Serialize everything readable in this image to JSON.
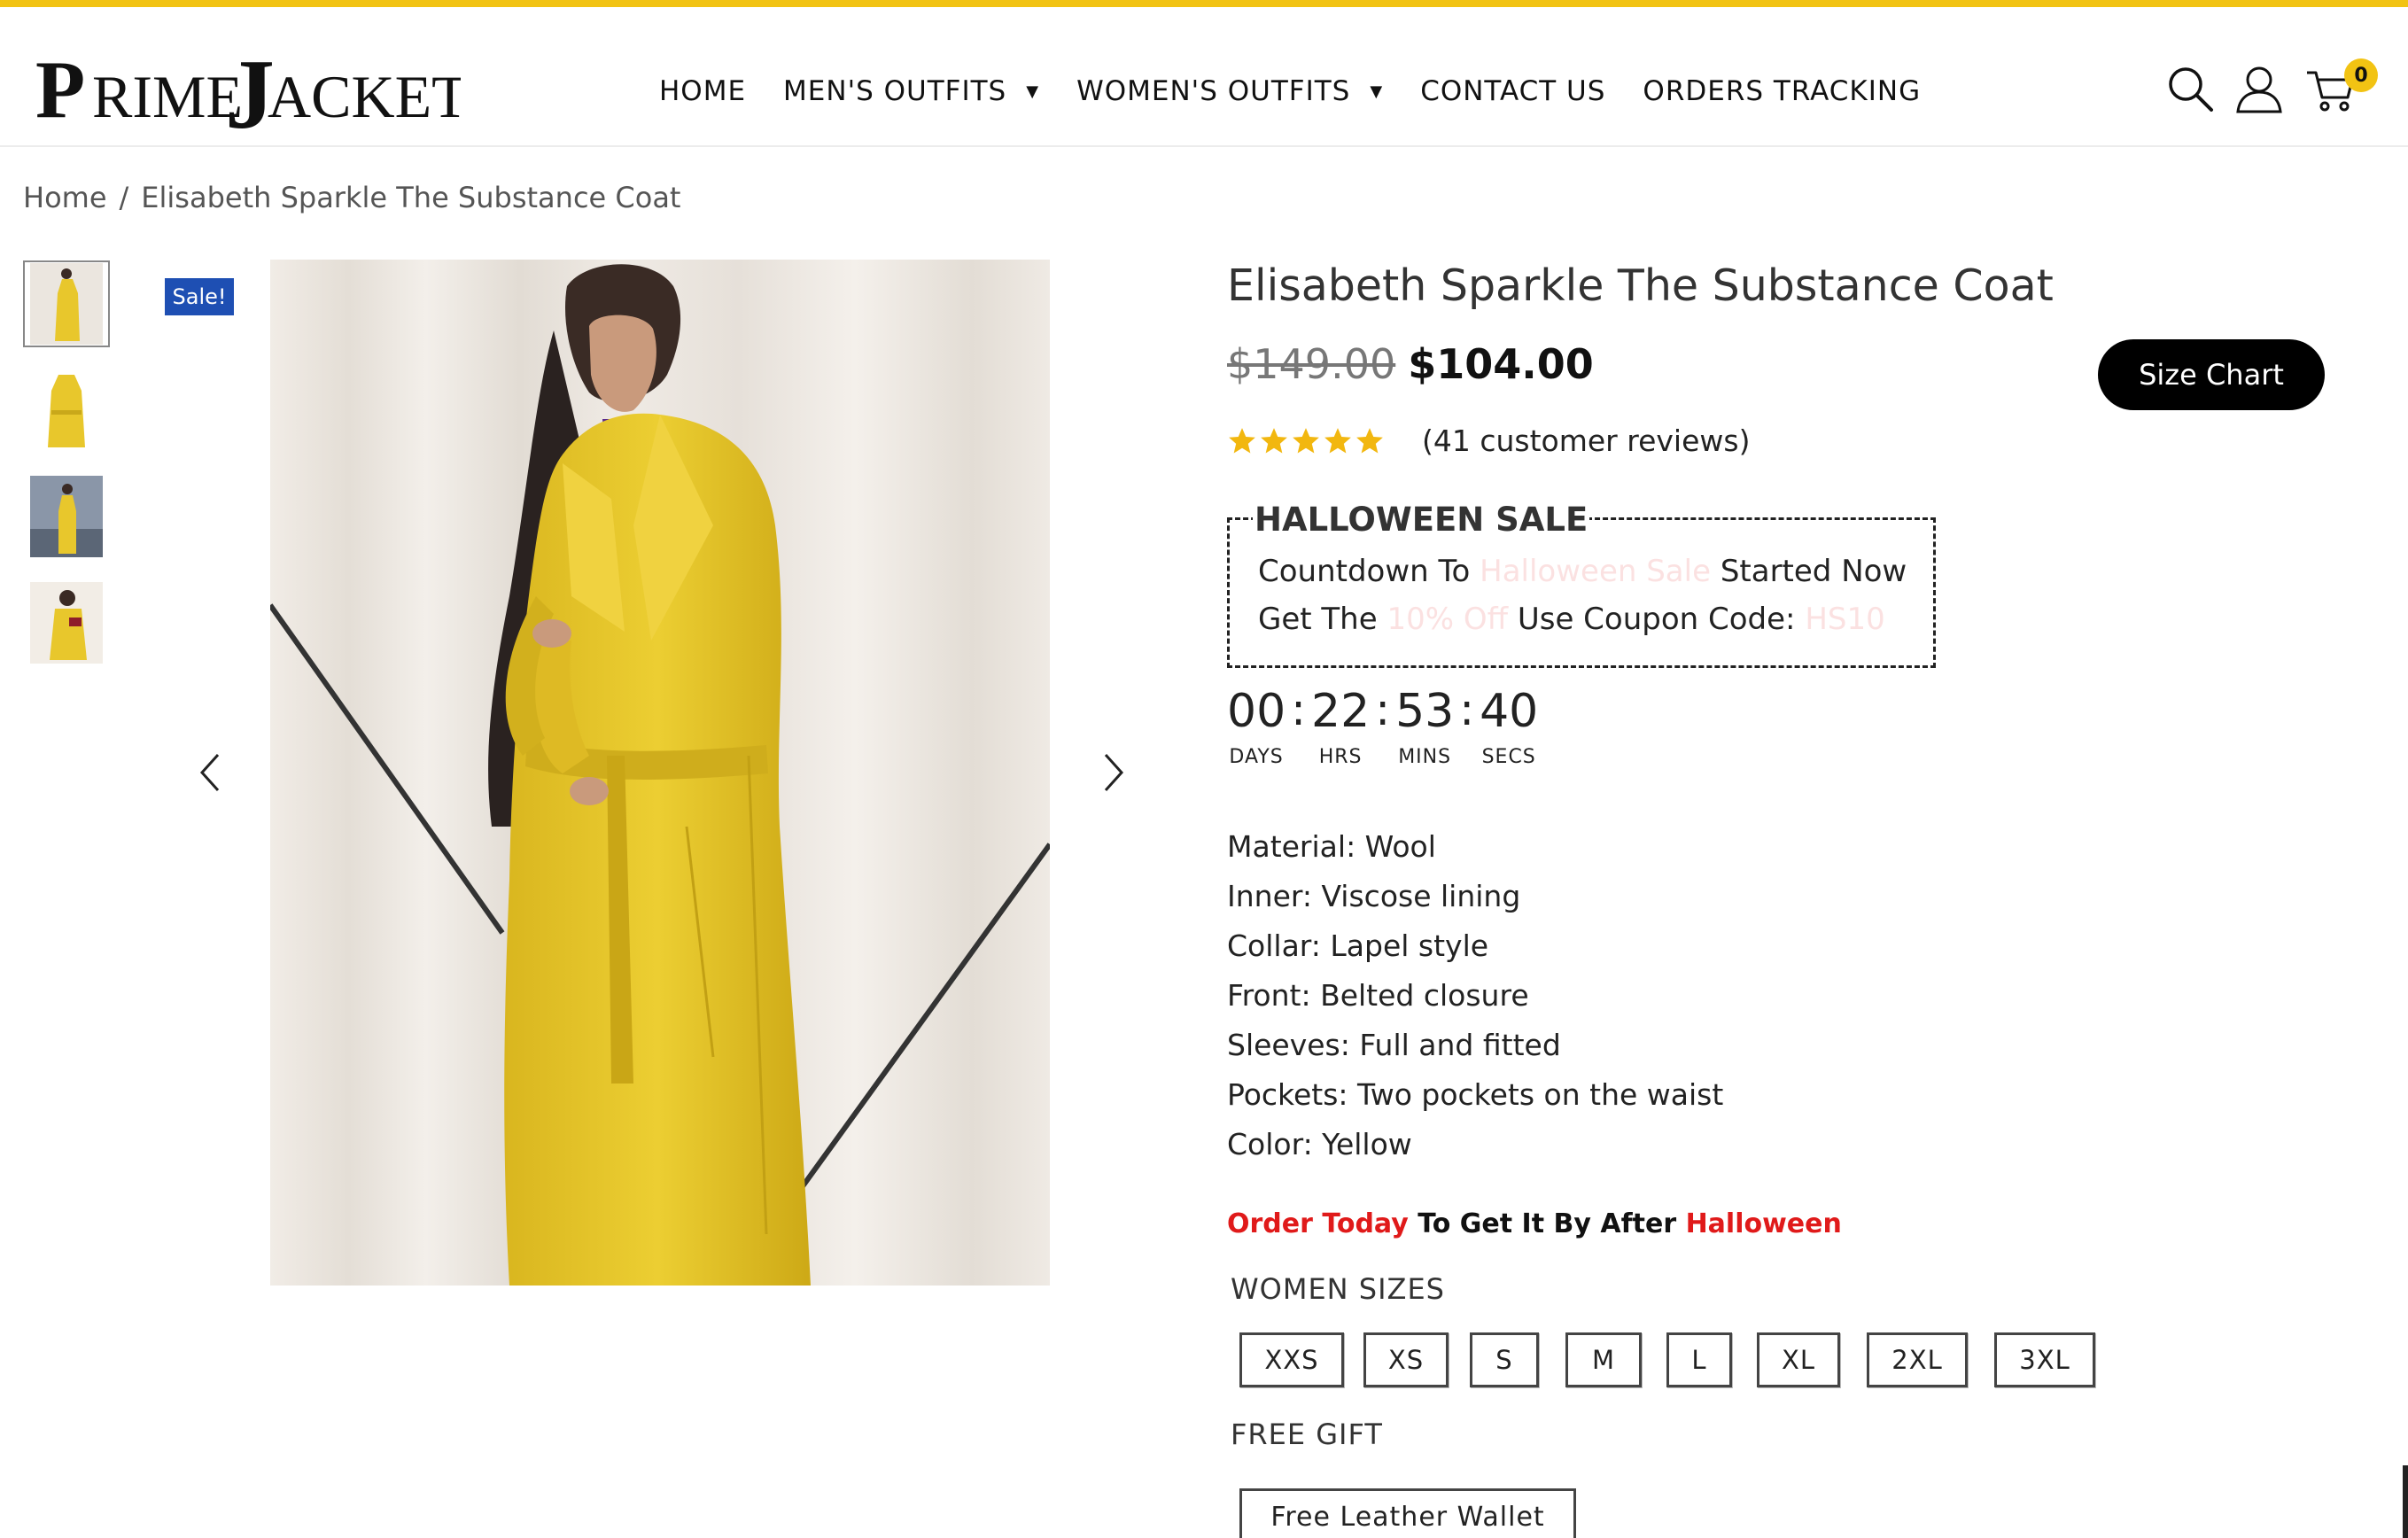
{
  "header": {
    "logo_text": "PRIME JACKETS",
    "nav": [
      {
        "label": "HOME",
        "has_dropdown": false
      },
      {
        "label": "MEN'S OUTFITS",
        "has_dropdown": true
      },
      {
        "label": "WOMEN'S OUTFITS",
        "has_dropdown": true
      },
      {
        "label": "CONTACT US",
        "has_dropdown": false
      },
      {
        "label": "ORDERS TRACKING",
        "has_dropdown": false
      }
    ],
    "icons": [
      "search-icon",
      "user-icon",
      "cart-icon"
    ],
    "cart_count": "0"
  },
  "breadcrumb": {
    "home": "Home",
    "separator": "/",
    "current": "Elisabeth Sparkle The Substance Coat"
  },
  "gallery": {
    "sale_badge": "Sale!",
    "thumbnail_count": 4,
    "prev_icon": "chevron-left-icon",
    "next_icon": "chevron-right-icon"
  },
  "product": {
    "title": "Elisabeth Sparkle The Substance Coat",
    "old_price": "$149.00",
    "new_price": "$104.00",
    "size_chart_label": "Size Chart",
    "rating": 5,
    "reviews": "(41 customer reviews)"
  },
  "sale_box": {
    "title": "HALLOWEEN SALE",
    "line1_a": "Countdown To",
    "line1_b": "Halloween Sale",
    "line1_c": "Started Now",
    "line2_a": "Get The",
    "line2_b": "10% Off",
    "line2_c": "Use Coupon Code:",
    "line2_d": "HS10"
  },
  "countdown": {
    "days": "00",
    "hrs": "22",
    "mins": "53",
    "secs": "40",
    "days_label": "DAYS",
    "hrs_label": "HRS",
    "mins_label": "MINS",
    "secs_label": "SECS"
  },
  "features": [
    "Material: Wool",
    "Inner: Viscose lining",
    "Collar: Lapel style",
    "Front: Belted closure",
    "Sleeves: Full and fitted",
    "Pockets: Two pockets on the waist",
    "Color: Yellow"
  ],
  "order_line": {
    "a": "Order Today",
    "b": " To Get It By After ",
    "c": "Halloween"
  },
  "sizes": {
    "heading": "WOMEN SIZES",
    "options": [
      "XXS",
      "XS",
      "S",
      "M",
      "L",
      "XL",
      "2XL",
      "3XL"
    ]
  },
  "gift": {
    "heading": "FREE GIFT",
    "option": "Free Leather Wallet"
  },
  "colors": {
    "accent": "#f2c313",
    "sale_badge": "#1e4fb3",
    "highlight_red": "#e01a1a",
    "star": "#f2b70f",
    "coat": "#e8c72c"
  }
}
